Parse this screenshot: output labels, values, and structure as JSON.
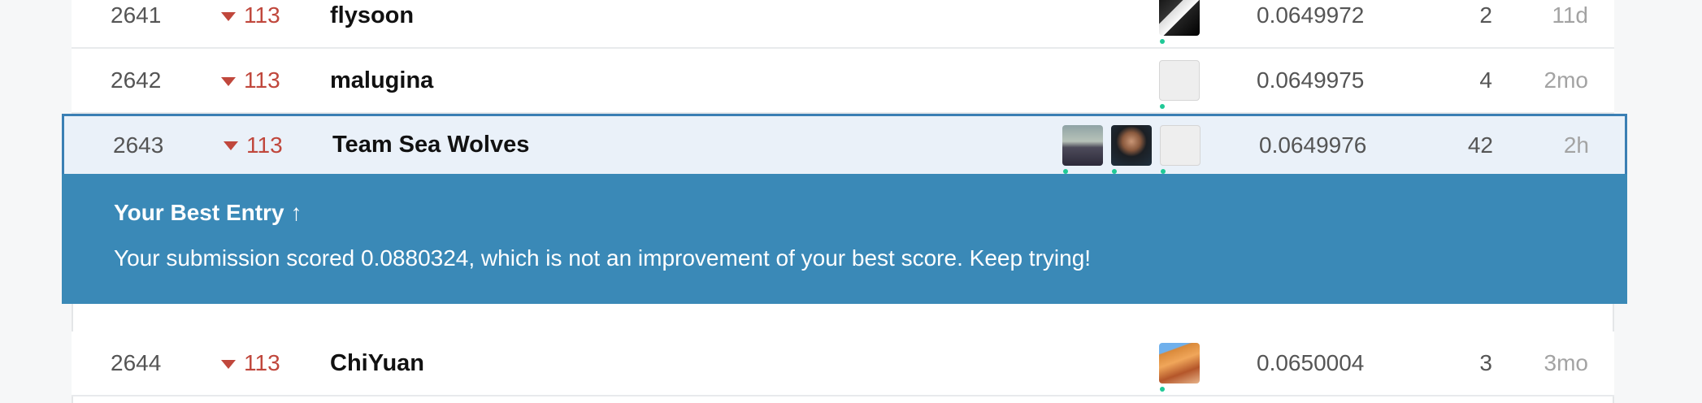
{
  "leaderboard": {
    "rows": [
      {
        "rank": "2641",
        "change": "113",
        "team": "flysoon",
        "score": "0.0649972",
        "entries": "2",
        "last": "11d",
        "avatars": [
          "origami-avatar"
        ]
      },
      {
        "rank": "2642",
        "change": "113",
        "team": "malugina",
        "score": "0.0649975",
        "entries": "4",
        "last": "2mo",
        "avatars": [
          "default-goose-avatar"
        ]
      },
      {
        "rank": "2643",
        "change": "113",
        "team": "Team Sea Wolves",
        "score": "0.0649976",
        "entries": "42",
        "last": "2h",
        "avatars": [
          "member-photo-avatar",
          "member-photo-avatar",
          "default-goose-avatar"
        ]
      },
      {
        "rank": "2644",
        "change": "113",
        "team": "ChiYuan",
        "score": "0.0650004",
        "entries": "3",
        "last": "3mo",
        "avatars": [
          "canyon-photo-avatar"
        ]
      }
    ]
  },
  "best_entry": {
    "title": "Your Best Entry",
    "arrow": "↑",
    "message": "Your submission scored 0.0880324, which is not an improvement of your best score. Keep trying!"
  },
  "colors": {
    "banner": "#3a89b7",
    "highlight_border": "#3a7fb4",
    "rank_down": "#c0473c",
    "online_dot": "#20c997"
  }
}
